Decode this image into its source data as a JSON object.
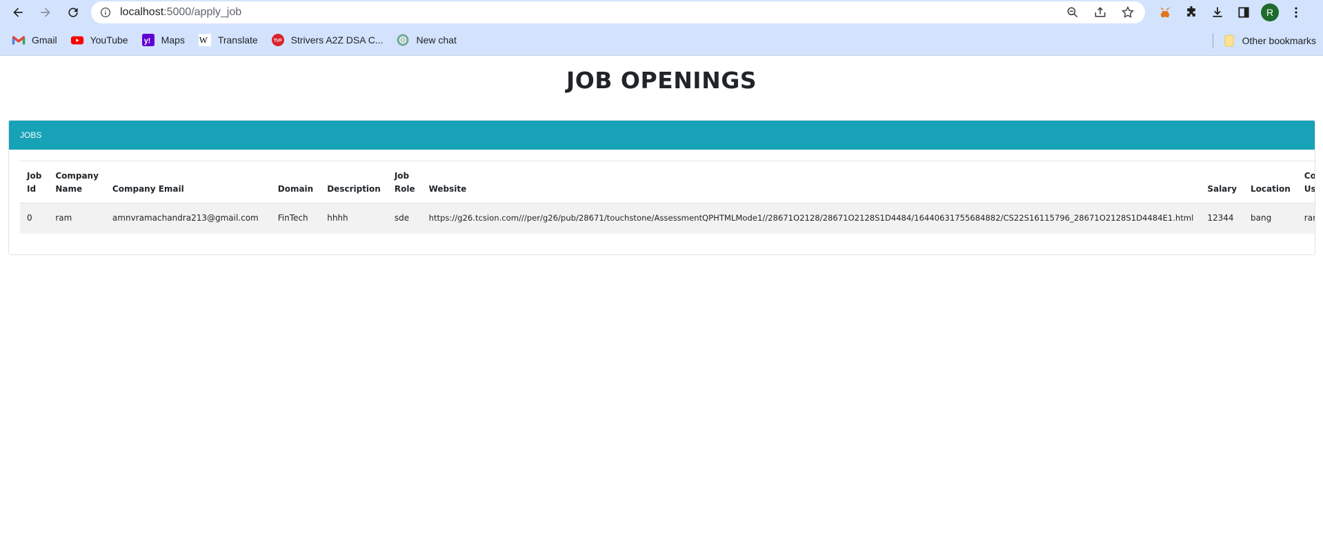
{
  "browser": {
    "url_host": "localhost",
    "url_rest": ":5000/apply_job",
    "avatar_letter": "R",
    "bookmarks": [
      {
        "label": "Gmail",
        "icon": "gmail-icon"
      },
      {
        "label": "YouTube",
        "icon": "youtube-icon"
      },
      {
        "label": "Maps",
        "icon": "yahoo-icon"
      },
      {
        "label": "Translate",
        "icon": "wikipedia-icon"
      },
      {
        "label": "Strivers A2Z DSA C...",
        "icon": "tuf-icon"
      },
      {
        "label": "New chat",
        "icon": "chatgpt-icon"
      }
    ],
    "other_bookmarks": "Other bookmarks"
  },
  "page": {
    "title": "JOB OPENINGS",
    "card_header": "JOBS",
    "accent_color": "#17a2b8"
  },
  "table": {
    "headers": [
      {
        "line1": "Job",
        "line2": "Id"
      },
      {
        "line1": "Company",
        "line2": "Name"
      },
      {
        "line1": "",
        "line2": "Company Email"
      },
      {
        "line1": "",
        "line2": "Domain"
      },
      {
        "line1": "",
        "line2": "Description"
      },
      {
        "line1": "Job",
        "line2": "Role"
      },
      {
        "line1": "",
        "line2": "Website"
      },
      {
        "line1": "",
        "line2": "Salary"
      },
      {
        "line1": "",
        "line2": "Location"
      },
      {
        "line1": "Company",
        "line2": "Username"
      }
    ],
    "rows": [
      {
        "job_id": "0",
        "company_name": "ram",
        "company_email": "amnvramachandra213@gmail.com",
        "domain": "FinTech",
        "description": "hhhh",
        "job_role": "sde",
        "website": "https://g26.tcsion.com///per/g26/pub/28671/touchstone/AssessmentQPHTMLMode1//28671O2128/28671O2128S1D4484/16440631755684882/CS22S16115796_28671O2128S1D4484E1.html",
        "salary": "12344",
        "location": "bang",
        "company_username": "ram"
      }
    ]
  }
}
